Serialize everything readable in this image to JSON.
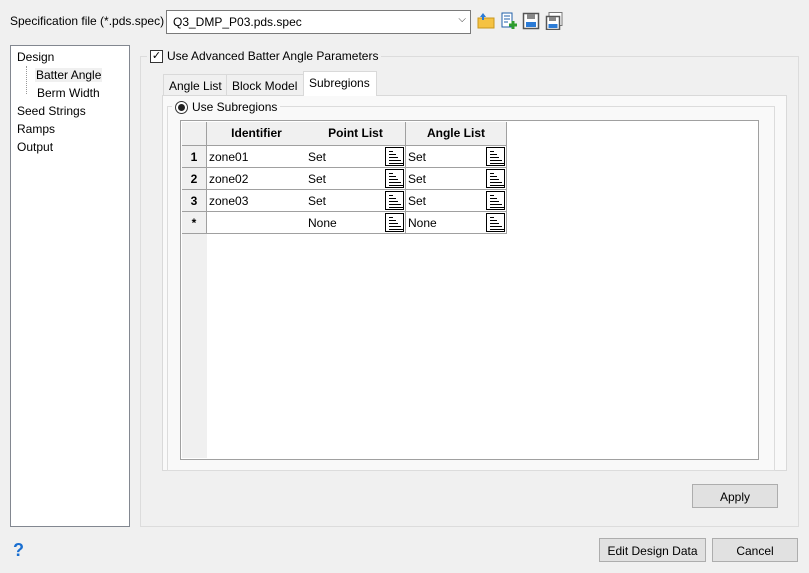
{
  "spec": {
    "label": "Specification file (*.pds.spec)",
    "value": "Q3_DMP_P03.pds.spec"
  },
  "toolbar": [
    "open-folder-icon",
    "new-file-icon",
    "save-icon",
    "save-as-icon"
  ],
  "tree": [
    {
      "label": "Design",
      "level": 0
    },
    {
      "label": "Batter Angle",
      "level": 1,
      "selected": true
    },
    {
      "label": "Berm Width",
      "level": 1
    },
    {
      "label": "Seed Strings",
      "level": 0
    },
    {
      "label": "Ramps",
      "level": 0
    },
    {
      "label": "Output",
      "level": 0
    }
  ],
  "advanced": {
    "label": "Use Advanced Batter Angle Parameters",
    "checked": true
  },
  "tabs": [
    "Angle List",
    "Block Model",
    "Subregions"
  ],
  "active_tab": "Subregions",
  "subregions": {
    "label": "Use Subregions",
    "selected": true
  },
  "grid": {
    "headers": [
      "Identifier",
      "Point List",
      "Angle List"
    ],
    "rows": [
      {
        "num": "1",
        "id": "zone01",
        "point": "Set",
        "angle": "Set"
      },
      {
        "num": "2",
        "id": "zone02",
        "point": "Set",
        "angle": "Set"
      },
      {
        "num": "3",
        "id": "zone03",
        "point": "Set",
        "angle": "Set"
      },
      {
        "num": "*",
        "id": "",
        "point": "None",
        "angle": "None"
      }
    ]
  },
  "buttons": {
    "apply": "Apply",
    "edit": "Edit Design Data",
    "cancel": "Cancel",
    "help": "?"
  }
}
